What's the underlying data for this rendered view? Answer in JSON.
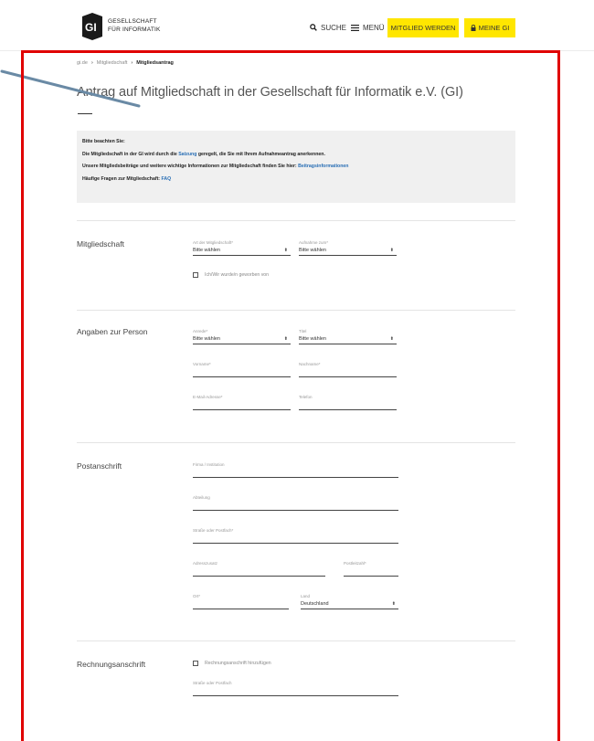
{
  "header": {
    "logo_line1": "GESELLSCHAFT",
    "logo_line2": "FÜR INFORMATIK",
    "search_label": "SUCHE",
    "menu_label": "MENÜ",
    "member_button": "MITGLIED WERDEN",
    "meine_button": "MEINE GI"
  },
  "breadcrumb": {
    "home": "gi.de",
    "section": "Mitgliedschaft",
    "current": "Mitgliedsantrag",
    "separator": "›"
  },
  "page_title": "Antrag auf Mitgliedschaft in der Gesellschaft für Informatik e.V. (GI)",
  "info": {
    "heading": "Bitte beachten Sie:",
    "line1_before": "Die Mitgliedschaft in der GI wird durch die ",
    "line1_link": "Satzung",
    "line1_after": " geregelt, die Sie mit Ihrem Aufnahmeantrag anerkennen.",
    "line2_before": "Unsere Mitgliedsbeiträge und weitere wichtige Informationen zur Mitgliedschaft finden Sie hier: ",
    "line2_link": "Beitragsinformationen",
    "line3_before": "Häufige Fragen zur Mitgliedschaft: ",
    "line3_link": "FAQ"
  },
  "sections": {
    "membership": {
      "title": "Mitgliedschaft",
      "art_label": "Art der Mitgliedschaft*",
      "art_value": "Bitte wählen",
      "aufnahme_label": "Aufnahme zum*",
      "aufnahme_value": "Bitte wählen",
      "geworben_label": "Ich/Wir wurde/n geworben von"
    },
    "person": {
      "title": "Angaben zur Person",
      "anrede_label": "Anrede*",
      "anrede_value": "Bitte wählen",
      "titel_label": "Titel",
      "titel_value": "Bitte wählen",
      "vorname_label": "Vorname*",
      "nachname_label": "Nachname*",
      "email_label": "E-Mail-Adresse*",
      "telefon_label": "Telefon"
    },
    "postal": {
      "title": "Postanschrift",
      "firma_label": "Firma / Institution",
      "abteilung_label": "Abteilung",
      "strasse_label": "Straße oder Postfach*",
      "adresszusatz_label": "Adresszusatz",
      "plz_label": "Postleitzahl*",
      "ort_label": "Ort*",
      "land_label": "Land",
      "land_value": "Deutschland"
    },
    "billing": {
      "title": "Rechnungsanschrift",
      "add_label": "Rechnungsanschrift hinzufügen",
      "strasse_label": "Straße oder Postfach"
    }
  },
  "colors": {
    "accent_yellow": "#ffe600",
    "link_blue": "#2a6fb5",
    "annotation_red": "#e00000",
    "arrow_blue": "#6a8aa5"
  }
}
